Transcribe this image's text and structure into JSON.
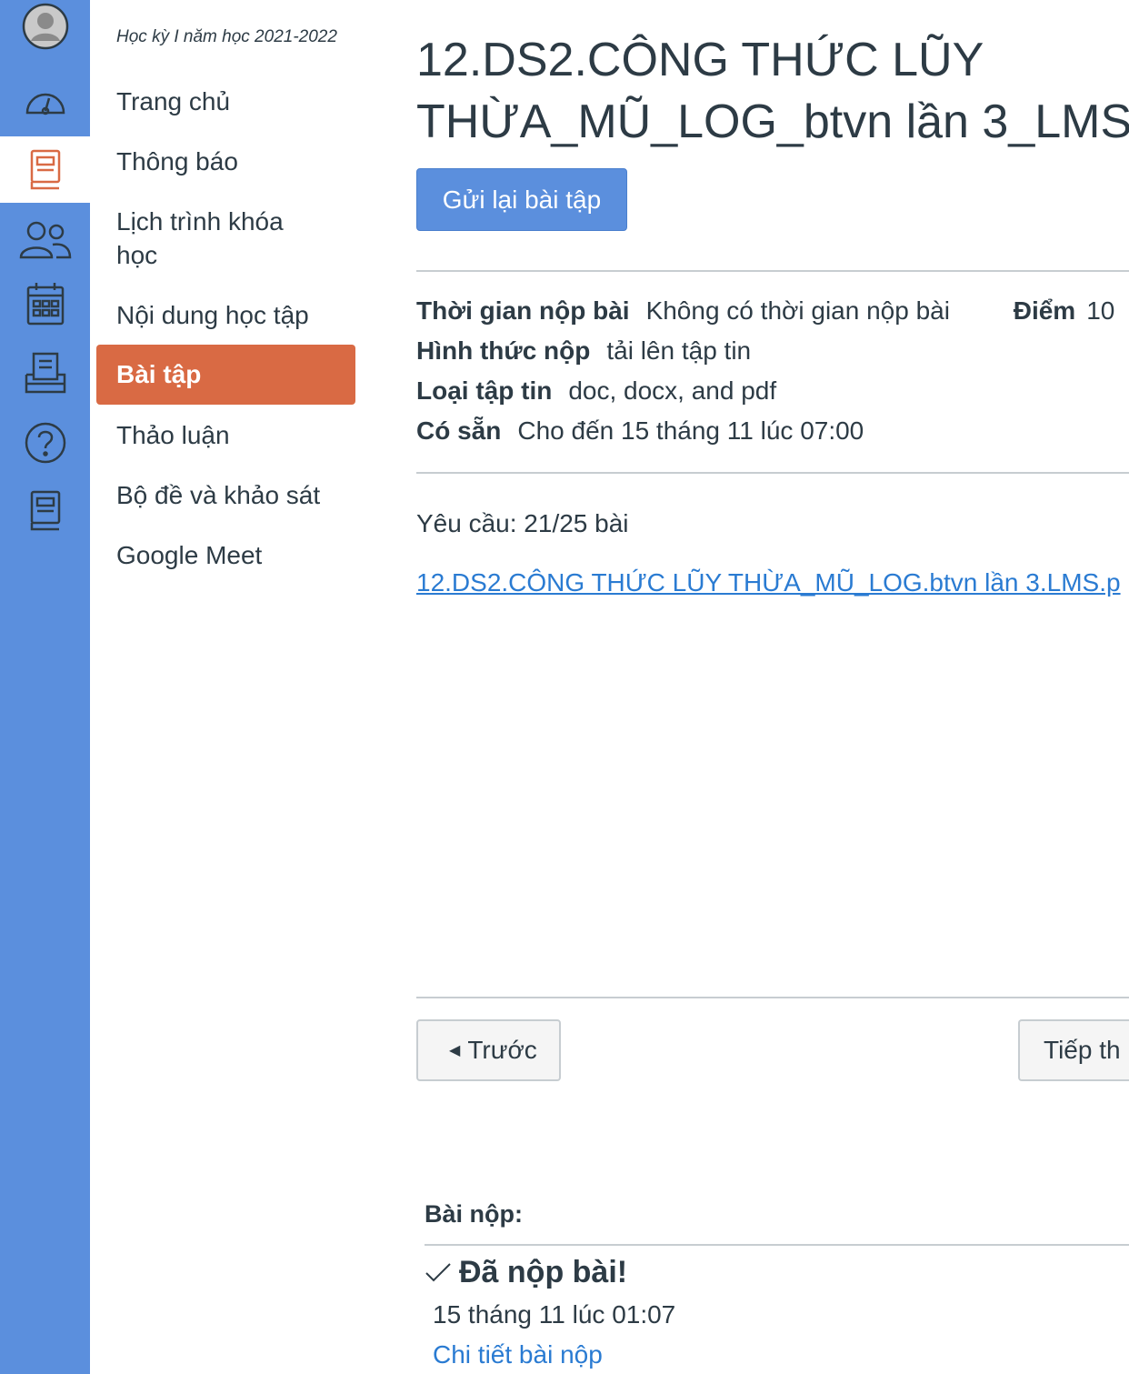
{
  "rail": {
    "items": [
      {
        "name": "account-avatar-icon"
      },
      {
        "name": "dashboard-icon"
      },
      {
        "name": "courses-icon",
        "active": true
      },
      {
        "name": "groups-icon"
      },
      {
        "name": "calendar-icon"
      },
      {
        "name": "inbox-icon"
      },
      {
        "name": "help-icon"
      },
      {
        "name": "commons-icon"
      }
    ]
  },
  "course_nav": {
    "term": "Học kỳ I năm học 2021-2022",
    "items": [
      {
        "label": "Trang chủ"
      },
      {
        "label": "Thông báo"
      },
      {
        "label": "Lịch trình khóa học"
      },
      {
        "label": "Nội dung học tập"
      },
      {
        "label": "Bài tập",
        "active": true
      },
      {
        "label": "Thảo luận"
      },
      {
        "label": "Bộ đề và khảo sát"
      },
      {
        "label": "Google Meet"
      }
    ]
  },
  "assignment": {
    "title_line1": "12.DS2.CÔNG THỨC LŨY",
    "title_line2": "THỪA_MŨ_LOG_btvn lần 3_LMS",
    "resubmit_label": "Gửi lại bài tập",
    "due_label": "Thời gian nộp bài",
    "due_value": "Không có thời gian nộp bài",
    "points_label": "Điểm",
    "points_value": "10",
    "submit_type_label": "Hình thức nộp",
    "submit_type_value": "tải lên tập tin",
    "file_types_label": "Loại tập tin",
    "file_types_value": "doc, docx, and pdf",
    "available_label": "Có sẵn",
    "available_value": "Cho đến 15 tháng 11 lúc 07:00",
    "requirement": "Yêu cầu:  21/25 bài",
    "file_link": "12.DS2.CÔNG THỨC LŨY THỪA_MŨ_LOG.btvn lần 3.LMS.p"
  },
  "pager": {
    "prev_label": "Trước",
    "next_label": "Tiếp th"
  },
  "submission": {
    "header": "Bài nộp:",
    "status": "Đã nộp bài!",
    "date": "15 tháng 11 lúc 01:07",
    "details_link": "Chi tiết bài nộp"
  },
  "colors": {
    "rail": "#5b8fdd",
    "active_nav": "#d96a44",
    "link": "#2a7bd2",
    "text": "#2d3b45"
  }
}
